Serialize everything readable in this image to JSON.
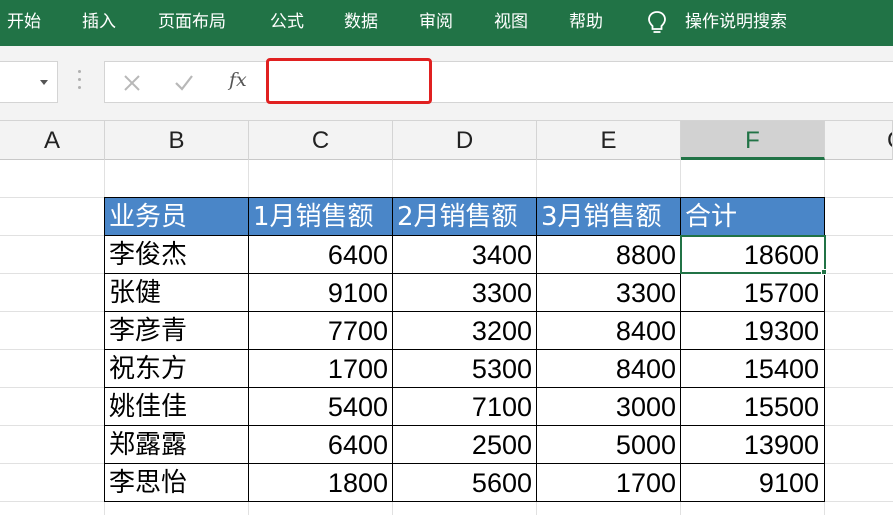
{
  "ribbon": {
    "tabs": [
      "开始",
      "插入",
      "页面布局",
      "公式",
      "数据",
      "审阅",
      "视图",
      "帮助"
    ],
    "tell_me": "操作说明搜索"
  },
  "formula_bar": {
    "fx": "fx",
    "value": ""
  },
  "columns": [
    "A",
    "B",
    "C",
    "D",
    "E",
    "F",
    "G"
  ],
  "selected_column": "F",
  "table": {
    "headers": [
      "业务员",
      "1月销售额",
      "2月销售额",
      "3月销售额",
      "合计"
    ],
    "rows": [
      [
        "李俊杰",
        "6400",
        "3400",
        "8800",
        "18600"
      ],
      [
        "张健",
        "9100",
        "3300",
        "3300",
        "15700"
      ],
      [
        "李彦青",
        "7700",
        "3200",
        "8400",
        "19300"
      ],
      [
        "祝东方",
        "1700",
        "5300",
        "8400",
        "15400"
      ],
      [
        "姚佳佳",
        "5400",
        "7100",
        "3000",
        "15500"
      ],
      [
        "郑露露",
        "6400",
        "2500",
        "5000",
        "13900"
      ],
      [
        "李思怡",
        "1800",
        "5600",
        "1700",
        "9100"
      ]
    ]
  },
  "colors": {
    "ribbon": "#217346",
    "header_fill": "#4a86c8",
    "highlight": "#e02020"
  }
}
